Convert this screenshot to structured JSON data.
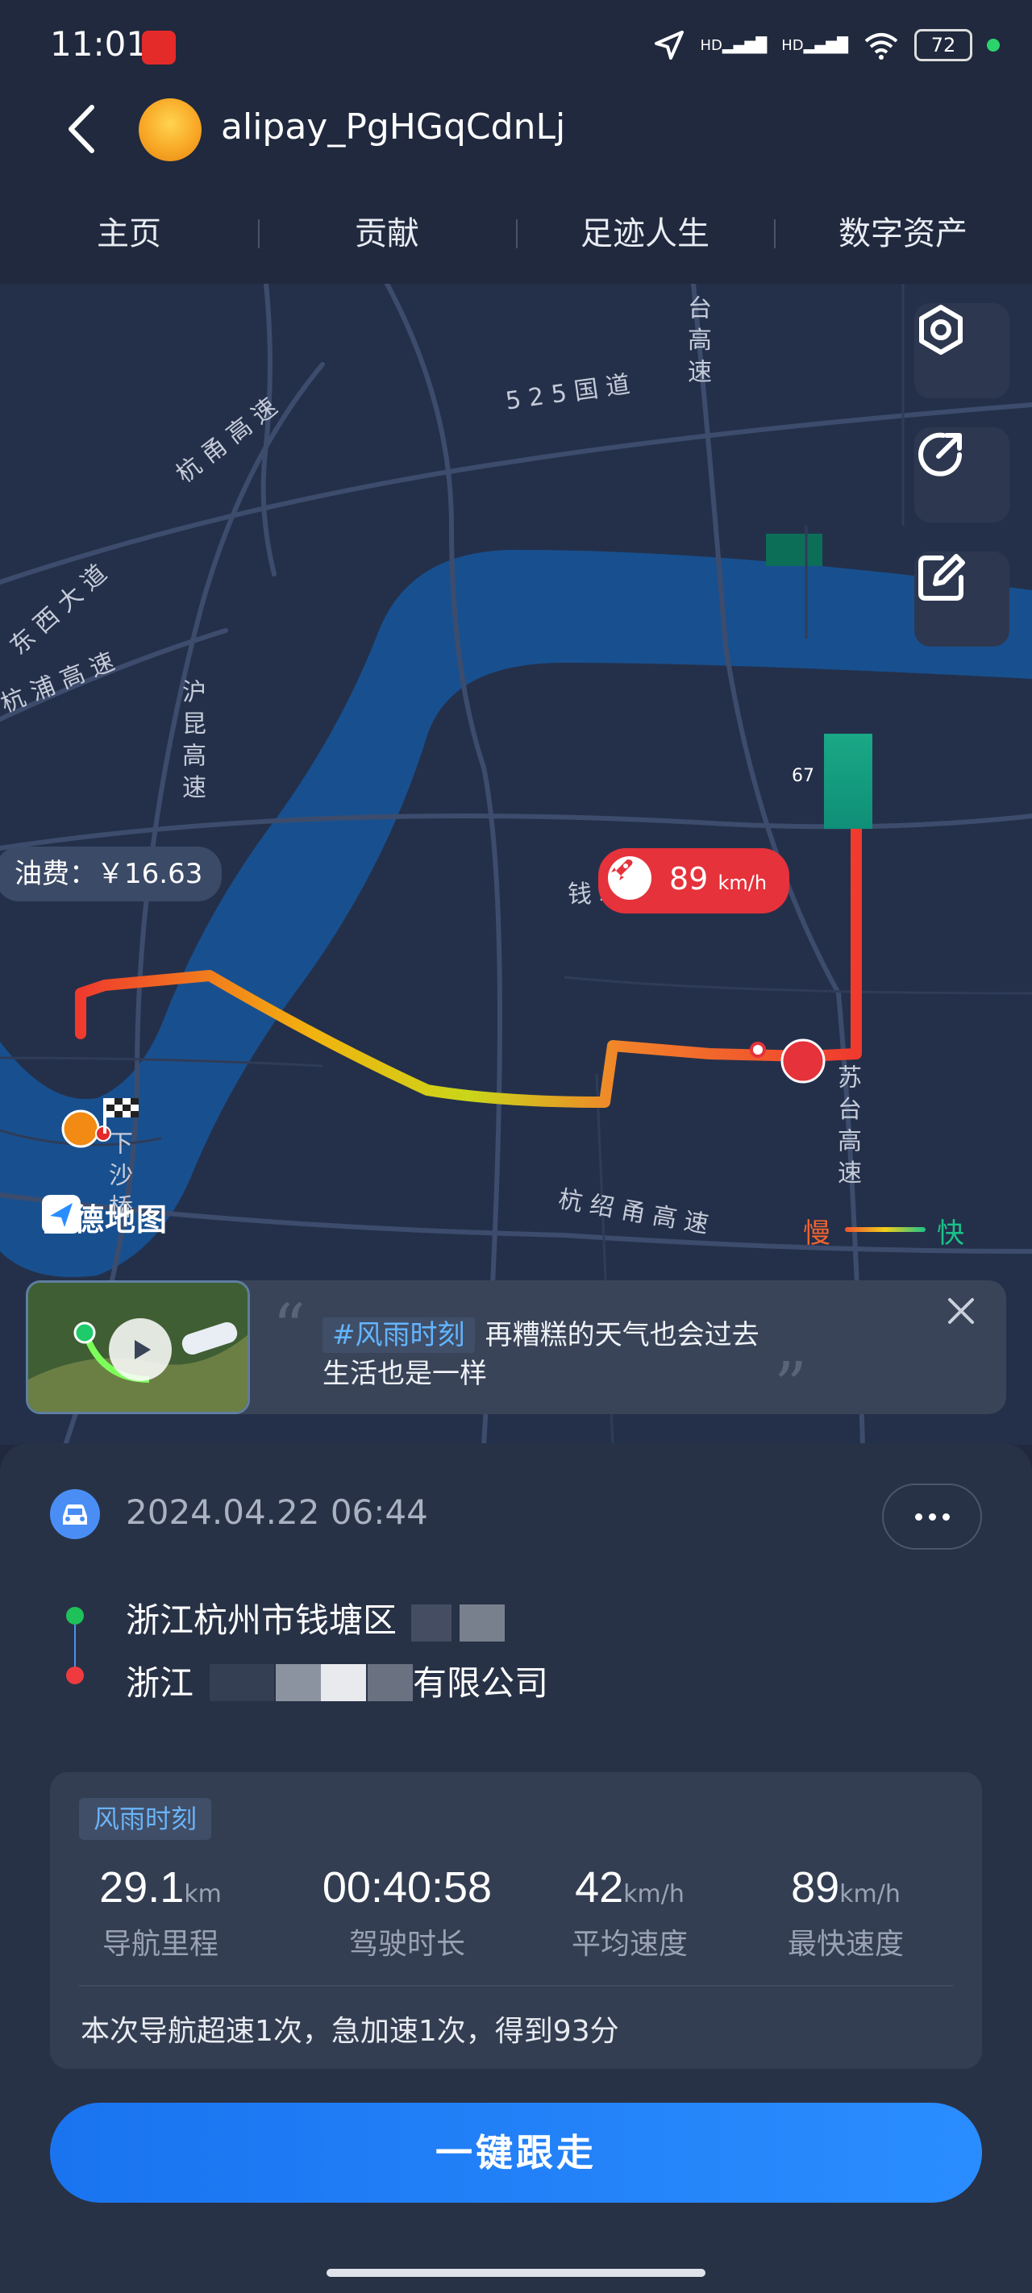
{
  "status_bar": {
    "time": "11:01",
    "signal1": "HD",
    "signal2": "HD",
    "battery": "72"
  },
  "header": {
    "username": "alipay_PgHGqCdnLj"
  },
  "tabs": [
    {
      "label": "主页"
    },
    {
      "label": "贡献"
    },
    {
      "label": "足迹人生"
    },
    {
      "label": "数字资产"
    }
  ],
  "map": {
    "road_labels": {
      "r1": "5 2 5 国 道",
      "r2": "杭 甬 高 速",
      "r3": "东 西 大 道",
      "r4": "杭 浦 高 速",
      "r5": "沪 昆 高 速",
      "r6": "台 高 速",
      "r7": "苏 台 高 速",
      "r8": "杭 绍 甬 高 速",
      "r9": "下 沙 桥",
      "r10": "钱 塘"
    },
    "toll_label": "油费：￥16.63",
    "speed_value": "89",
    "speed_unit": "km/h",
    "speed_marker": "67",
    "logo_text": "高德地图",
    "legend_slow": "慢",
    "legend_fast": "快"
  },
  "promo": {
    "tag": "#风雨时刻",
    "line1": "再糟糕的天气也会过去",
    "line2": "生活也是一样"
  },
  "trip": {
    "datetime": "2024.04.22 06:44",
    "start_address": "浙江杭州市钱塘区",
    "end_address_prefix": "浙江",
    "end_address_suffix": "有限公司",
    "tag": "风雨时刻",
    "stats": [
      {
        "value": "29.1",
        "unit": "km",
        "label": "导航里程"
      },
      {
        "value": "00:40:58",
        "unit": "",
        "label": "驾驶时长"
      },
      {
        "value": "42",
        "unit": "km/h",
        "label": "平均速度"
      },
      {
        "value": "89",
        "unit": "km/h",
        "label": "最快速度"
      }
    ],
    "summary": "本次导航超速1次，急加速1次，得到93分",
    "follow_button": "一键跟走"
  },
  "colors": {
    "background": "#20293d",
    "river": "#18508f",
    "route_slow": "#f03a2e",
    "route_fast": "#0fc28d",
    "accent_blue": "#1a74f0"
  }
}
